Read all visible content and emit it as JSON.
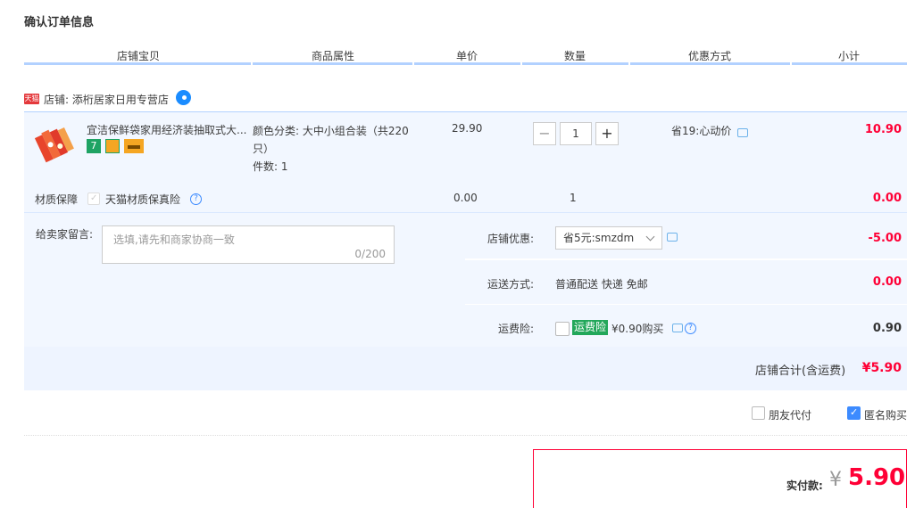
{
  "page_title": "确认订单信息",
  "columns": [
    "店铺宝贝",
    "商品属性",
    "单价",
    "数量",
    "优惠方式",
    "小计"
  ],
  "shop": {
    "badge": "天猫",
    "name": "店铺: 添桁居家日用专营店",
    "chat_icon": "wangwang-icon"
  },
  "item": {
    "title": "宜洁保鲜袋家用经济装抽取式大...",
    "service_icons": [
      "seven-day-return-icon",
      "guarantee-icon",
      "card-icon"
    ],
    "property": "颜色分类: 大中小组合装（共220只）",
    "count_label": "件数: 1",
    "price": "29.90",
    "quantity": "1",
    "qty_minus": "−",
    "qty_plus": "+",
    "promo": "省19:心动价",
    "subtotal": "10.90"
  },
  "insurance_row": {
    "label": "材质保障",
    "option": "天猫材质保真险",
    "price": "0.00",
    "quantity": "1",
    "subtotal": "0.00"
  },
  "message": {
    "label": "给卖家留言:",
    "placeholder": "选填,请先和商家协商一致",
    "counter": "0/200"
  },
  "shop_discount": {
    "label": "店铺优惠:",
    "selected": "省5元:smzdm",
    "amount": "-5.00"
  },
  "shipping": {
    "label": "运送方式:",
    "value": "普通配送 快递 免邮",
    "amount": "0.00"
  },
  "shipping_insurance": {
    "label": "运费险:",
    "tag": "运费险",
    "text": "¥0.90购买",
    "amount": "0.90"
  },
  "shop_total": {
    "label": "店铺合计(含运费)",
    "amount": "¥5.90"
  },
  "options": {
    "friend_pay": "朋友代付",
    "anonymous": "匿名购买",
    "anonymous_checked": true
  },
  "pay": {
    "label": "实付款:",
    "currency": "¥",
    "amount": "5.90"
  },
  "colors": {
    "accent_red": "#ff0036",
    "header_line": "#b2d1ff",
    "panel_bg": "#f2f7ff",
    "check_blue": "#3d8bff"
  }
}
